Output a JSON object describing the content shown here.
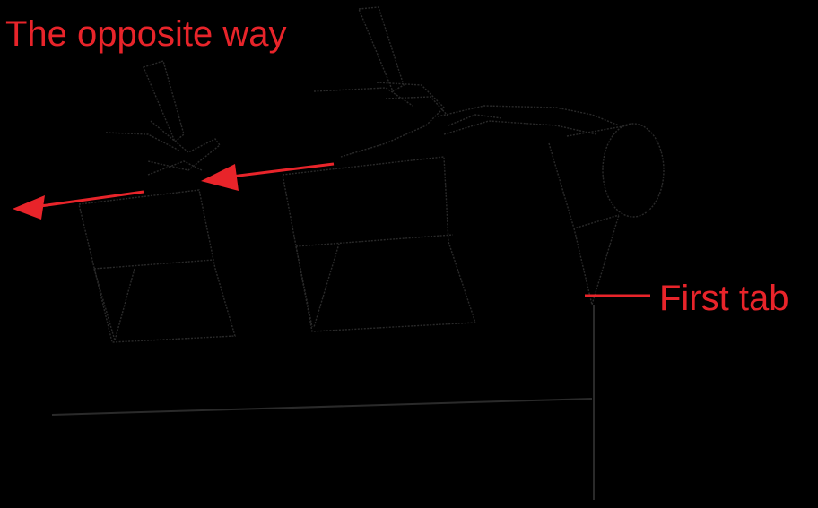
{
  "labels": {
    "opposite_way": "The opposite way",
    "first_tab": "First tab"
  },
  "colors": {
    "background": "#000000",
    "annotation": "#e8242a",
    "sketch": "#2a2a2a"
  }
}
